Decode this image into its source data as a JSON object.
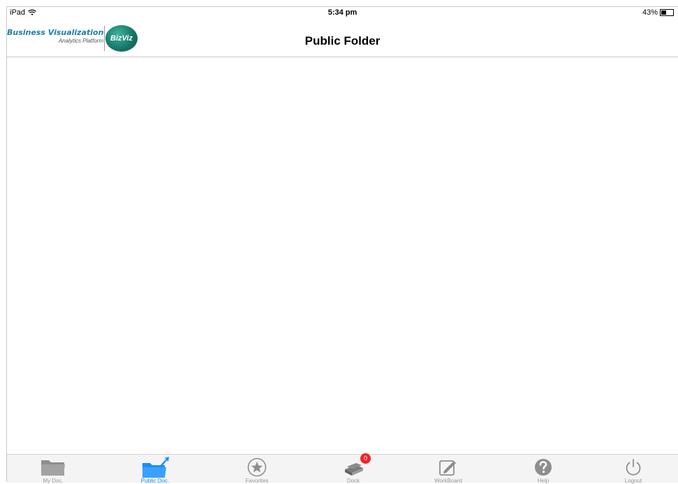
{
  "status_bar": {
    "device": "iPad",
    "time": "5:34 pm",
    "battery": "43%",
    "battery_level": 0.43
  },
  "header": {
    "logo_title": "Business Visualization",
    "logo_subtitle": "Analytics Platform",
    "logo_badge": "BizViz",
    "title": "Public Folder"
  },
  "tabs": [
    {
      "label": "My Doc.",
      "icon": "folder-icon",
      "active": false
    },
    {
      "label": "Public Doc.",
      "icon": "public-folder-icon",
      "active": true
    },
    {
      "label": "Favorites",
      "icon": "star-icon",
      "active": false
    },
    {
      "label": "Dock",
      "icon": "dock-icon",
      "active": false,
      "badge": "0"
    },
    {
      "label": "WorkBoard",
      "icon": "workboard-icon",
      "active": false
    },
    {
      "label": "Help",
      "icon": "help-icon",
      "active": false
    },
    {
      "label": "Logout",
      "icon": "power-icon",
      "active": false
    }
  ],
  "colors": {
    "active": "#1a8ff5",
    "inactive": "#999999",
    "badge": "#f0232b",
    "brand": "#1f7ea5"
  }
}
